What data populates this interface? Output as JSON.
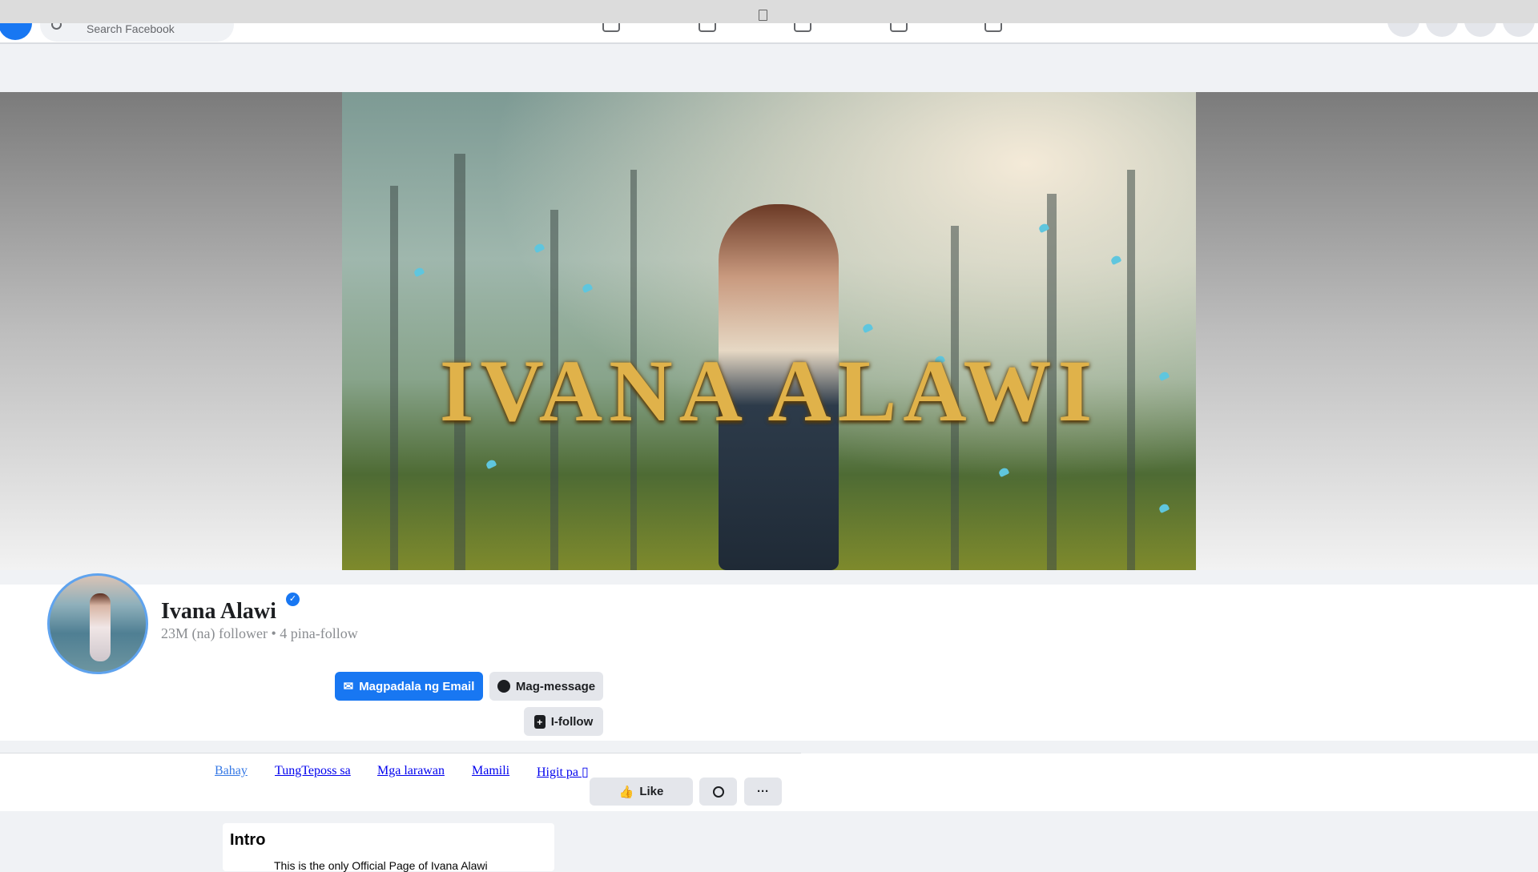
{
  "header": {
    "search_placeholder": "Search Facebook",
    "nav_icons": [
      "home-icon",
      "flag-icon",
      "watch-icon",
      "marketplace-icon",
      "groups-icon"
    ],
    "right_icons": [
      "menu-icon",
      "messenger-icon",
      "notifications-icon",
      "account-icon"
    ]
  },
  "cover": {
    "title": "IVANA ALAWI"
  },
  "profile": {
    "name": "Ivana Alawi",
    "verified_mark": "✓",
    "followers": "23M (na) follower • 4 pina-follow",
    "email_button": "Magpadala ng Email",
    "message_button": "Mag-message",
    "follow_button": "I-follow"
  },
  "tabs": [
    {
      "label": "Bahay "
    },
    {
      "label": "TungTeposs sa "
    },
    {
      "label": "Mga larawan "
    },
    {
      "label": "Mamili "
    },
    {
      "label": "Higit pa ▯"
    }
  ],
  "actions": {
    "like": "Like",
    "more": "···"
  },
  "intro": {
    "title": "Intro",
    "text": "This is the only Official Page of Ivana Alawi"
  },
  "colors": {
    "accent": "#1877f2",
    "background": "#f0f2f5"
  }
}
